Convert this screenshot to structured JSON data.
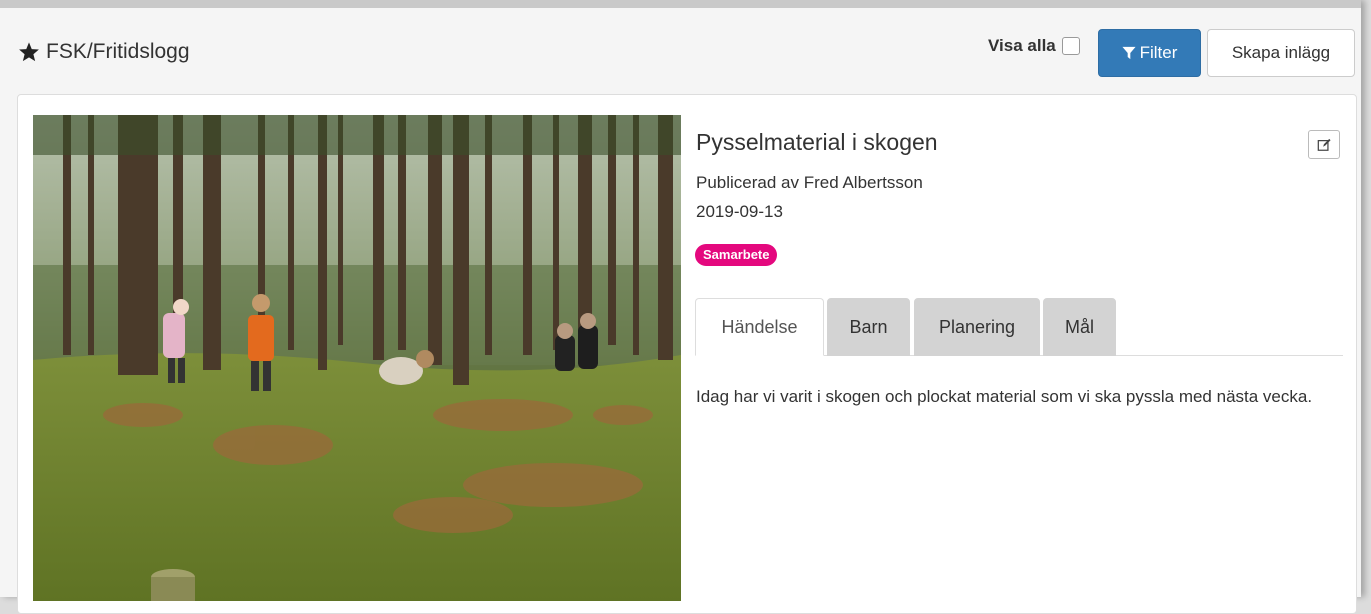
{
  "header": {
    "title": "FSK/Fritidslogg",
    "show_all_label": "Visa alla",
    "filter_label": "Filter",
    "create_label": "Skapa inlägg",
    "accent_color": "#337ab7"
  },
  "post": {
    "title": "Pysselmaterial i skogen",
    "published_by": "Publicerad av Fred Albertsson",
    "date": "2019-09-13",
    "tag": "Samarbete",
    "tag_color": "#e4087e",
    "image_icon": "forest-photo",
    "tabs": [
      {
        "label": "Händelse",
        "active": true
      },
      {
        "label": "Barn",
        "active": false
      },
      {
        "label": "Planering",
        "active": false
      },
      {
        "label": "Mål",
        "active": false
      }
    ],
    "content": "Idag har vi varit i skogen och plockat material som vi ska pyssla med nästa vecka."
  }
}
